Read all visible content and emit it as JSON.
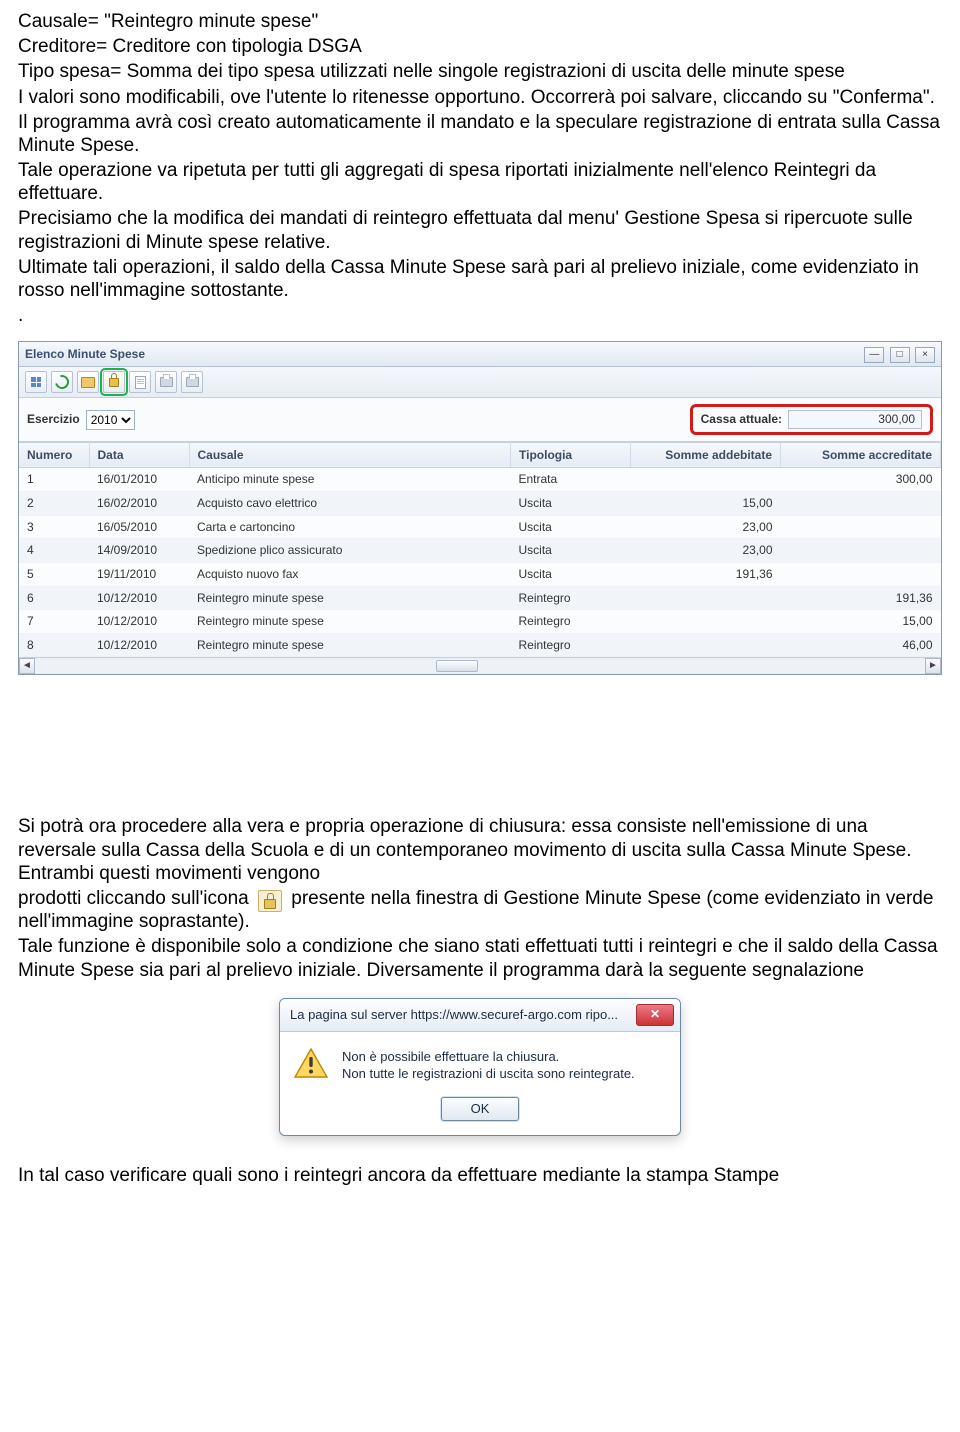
{
  "intro": {
    "line1_a": "Causale= \"Reintegro minute spese\"",
    "line2": "Creditore= Creditore con tipologia DSGA",
    "line3": "Tipo spesa= Somma dei tipo spesa utilizzati nelle singole registrazioni di uscita delle minute spese",
    "para1": "I valori sono modificabili, ove l'utente lo ritenesse opportuno. Occorrerà poi salvare, cliccando su \"Conferma\".",
    "para2": "Il programma avrà così creato automaticamente il mandato e la speculare registrazione di entrata sulla Cassa Minute Spese.",
    "para3": "Tale operazione va ripetuta per tutti gli aggregati di spesa riportati inizialmente nell'elenco Reintegri da effettuare.",
    "para4": "Precisiamo che la modifica dei mandati di reintegro effettuata dal menu' Gestione Spesa si ripercuote sulle registrazioni di  Minute spese relative.",
    "para5": "Ultimate tali operazioni, il saldo della Cassa Minute Spese sarà pari al prelievo iniziale, come evidenziato in rosso nell'immagine sottostante.",
    "dot": "."
  },
  "app": {
    "title": "Elenco Minute Spese",
    "win": {
      "min": "—",
      "max": "□",
      "close": "×"
    },
    "esercizio_label": "Esercizio",
    "esercizio_value": "2010",
    "cassa_label": "Cassa attuale:",
    "cassa_value": "300,00",
    "columns": {
      "numero": "Numero",
      "data": "Data",
      "causale": "Causale",
      "tipologia": "Tipologia",
      "addebitate": "Somme addebitate",
      "accreditate": "Somme accreditate"
    },
    "rows": [
      {
        "n": "1",
        "data": "16/01/2010",
        "causale": "Anticipo minute spese",
        "tip": "Entrata",
        "add": "",
        "acc": "300,00"
      },
      {
        "n": "2",
        "data": "16/02/2010",
        "causale": "Acquisto cavo elettrico",
        "tip": "Uscita",
        "add": "15,00",
        "acc": ""
      },
      {
        "n": "3",
        "data": "16/05/2010",
        "causale": "Carta e cartoncino",
        "tip": "Uscita",
        "add": "23,00",
        "acc": ""
      },
      {
        "n": "4",
        "data": "14/09/2010",
        "causale": "Spedizione plico assicurato",
        "tip": "Uscita",
        "add": "23,00",
        "acc": ""
      },
      {
        "n": "5",
        "data": "19/11/2010",
        "causale": "Acquisto nuovo fax",
        "tip": "Uscita",
        "add": "191,36",
        "acc": ""
      },
      {
        "n": "6",
        "data": "10/12/2010",
        "causale": "Reintegro minute spese",
        "tip": "Reintegro",
        "add": "",
        "acc": "191,36"
      },
      {
        "n": "7",
        "data": "10/12/2010",
        "causale": "Reintegro minute spese",
        "tip": "Reintegro",
        "add": "",
        "acc": "15,00"
      },
      {
        "n": "8",
        "data": "10/12/2010",
        "causale": "Reintegro minute spese",
        "tip": "Reintegro",
        "add": "",
        "acc": "46,00"
      }
    ]
  },
  "after": {
    "p1a": "Si potrà ora procedere alla vera e propria operazione di chiusura: essa consiste nell'emissione di una reversale sulla Cassa della Scuola e di un contemporaneo movimento di uscita sulla Cassa Minute Spese. Entrambi questi movimenti vengono",
    "p1b_pre": "prodotti cliccando sull'icona ",
    "p1b_post": " presente nella finestra di Gestione Minute Spese (come evidenziato in verde nell'immagine soprastante).",
    "p2": "Tale funzione è disponibile solo a condizione che siano stati effettuati tutti i reintegri e che il saldo della Cassa Minute Spese sia pari al prelievo iniziale. Diversamente il programma darà la seguente segnalazione"
  },
  "dialog": {
    "title": "La pagina sul server https://www.securef-argo.com ripo...",
    "line1": "Non è possibile effettuare la chiusura.",
    "line2": "Non tutte le registrazioni di uscita sono reintegrate.",
    "ok": "OK",
    "close_glyph": "✕"
  },
  "closing": "In tal caso verificare quali sono i reintegri ancora da effettuare mediante la stampa Stampe"
}
